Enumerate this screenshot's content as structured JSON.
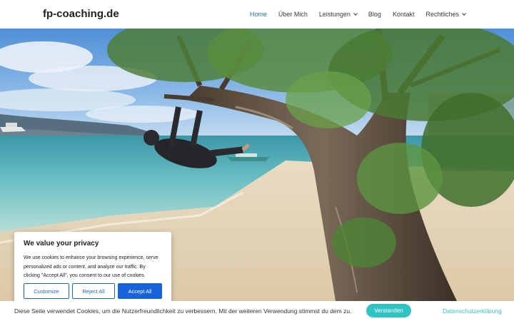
{
  "header": {
    "logo": "fp-coaching.de",
    "nav": [
      {
        "label": "Home",
        "active": true,
        "dropdown": false
      },
      {
        "label": "Über Mich",
        "active": false,
        "dropdown": false
      },
      {
        "label": "Leistungen",
        "active": false,
        "dropdown": true
      },
      {
        "label": "Blog",
        "active": false,
        "dropdown": false
      },
      {
        "label": "Kontakt",
        "active": false,
        "dropdown": false
      },
      {
        "label": "Rechtliches",
        "active": false,
        "dropdown": true
      }
    ]
  },
  "hero": {
    "image": "photo of a person climbing a tree branch on a tropical beach"
  },
  "cookie_box": {
    "title": "We value your privacy",
    "text": "We use cookies to enhance your browsing experience, serve personalized ads or content, and analyze our traffic. By clicking \"Accept All\", you consent to our use of cookies.",
    "customize_label": "Customize",
    "reject_label": "Reject All",
    "accept_label": "Accept All"
  },
  "bottom_bar": {
    "text": "Diese Seite verwendet Cookies, um die Nutzerfreundlichkeit zu verbessern. Mit der weiteren Verwendung stimmst du dem zu.",
    "accept_label": "Verstanden",
    "privacy_label": "Datenschutzerklärung"
  },
  "colors": {
    "accent": "#1e73be",
    "cookie_blue": "#1863dc",
    "teal": "#2ec4c4"
  }
}
